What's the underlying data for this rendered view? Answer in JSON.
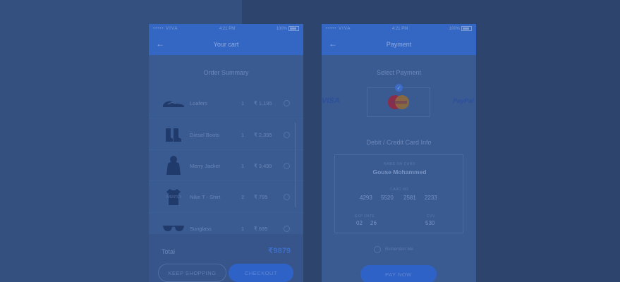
{
  "colors": {
    "background": "#2f4670",
    "navbar": "#3467c3",
    "accent": "#2f62c7"
  },
  "cart_screen": {
    "status": {
      "carrier": "••••• VIVA",
      "time": "4:21 PM",
      "battery": "100%"
    },
    "title": "Your cart",
    "section_title": "Order Summary",
    "items": [
      {
        "icon": "loafers-icon",
        "name": "Loafers",
        "qty": "1",
        "price": "₹ 1,195"
      },
      {
        "icon": "boots-icon",
        "name": "Diesel Boots",
        "qty": "1",
        "price": "₹ 2,395"
      },
      {
        "icon": "jacket-icon",
        "name": "Merry Jacket",
        "qty": "1",
        "price": "₹ 3,499"
      },
      {
        "icon": "tshirt-icon",
        "name": "Nike T - Shirt",
        "qty": "2",
        "price": "₹ 795"
      },
      {
        "icon": "sunglass-icon",
        "name": "Sunglass",
        "qty": "1",
        "price": "₹ 695"
      }
    ],
    "total_label": "Total",
    "total_value": "₹9879",
    "keep_shopping": "KEEP SHOPPING",
    "checkout": "CHECKOUT"
  },
  "payment_screen": {
    "status": {
      "carrier": "••••• VIVA",
      "time": "4:21 PM",
      "battery": "100%"
    },
    "title": "Payment",
    "section_title": "Select Payment",
    "methods": {
      "visa": "VISA",
      "paypal": "PayPal",
      "selected": "mastercard"
    },
    "card_info_title": "Debit / Credit Card Info",
    "card": {
      "name_label": "NAME ON CARD",
      "name": "Gouse Mohammed",
      "number_label": "CARD NO",
      "number": [
        "4293",
        "5520",
        "2581",
        "2233"
      ],
      "expiry_label": "EXP DATE",
      "exp_month": "02",
      "exp_year": "26",
      "cvv_label": "CVV",
      "cvv": "530"
    },
    "remember": "Remember Me",
    "pay_now": "PAY NOW"
  }
}
